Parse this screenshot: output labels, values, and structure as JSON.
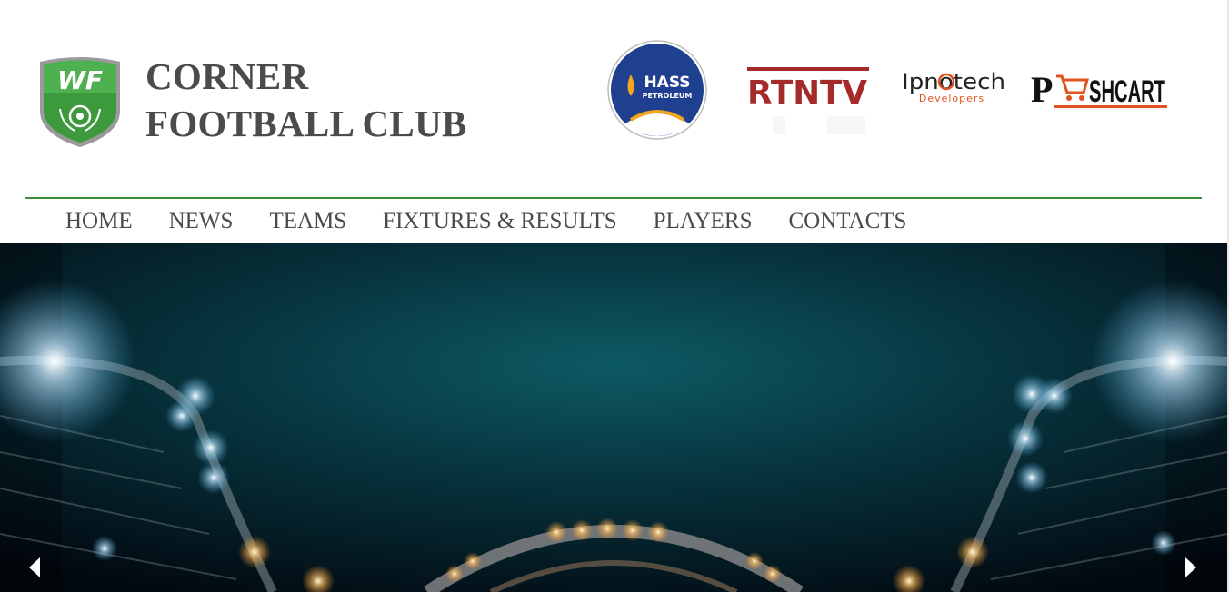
{
  "brand": {
    "logo_letters": "WF",
    "title_line1": "CORNER",
    "title_line2": "FOOTBALL CLUB",
    "logo_color": "#3c9a3c"
  },
  "sponsors": [
    {
      "name": "HASS PETROLEUM",
      "line1": "HASS",
      "line2": "PETROLEUM"
    },
    {
      "name": "RTN TV",
      "text": "RTNTV"
    },
    {
      "name": "Ipnotech Developers",
      "line1": "Ipnotech",
      "line2": "Developers"
    },
    {
      "name": "PUSHCART",
      "text": "SHCART"
    }
  ],
  "nav": {
    "items": [
      "HOME",
      "NEWS",
      "TEAMS",
      "FIXTURES & RESULTS",
      "PLAYERS",
      "CONTACTS"
    ],
    "rule_color": "#3a8f3a"
  },
  "slider": {
    "prev_icon": "chevron-left-icon",
    "next_icon": "chevron-right-icon"
  }
}
